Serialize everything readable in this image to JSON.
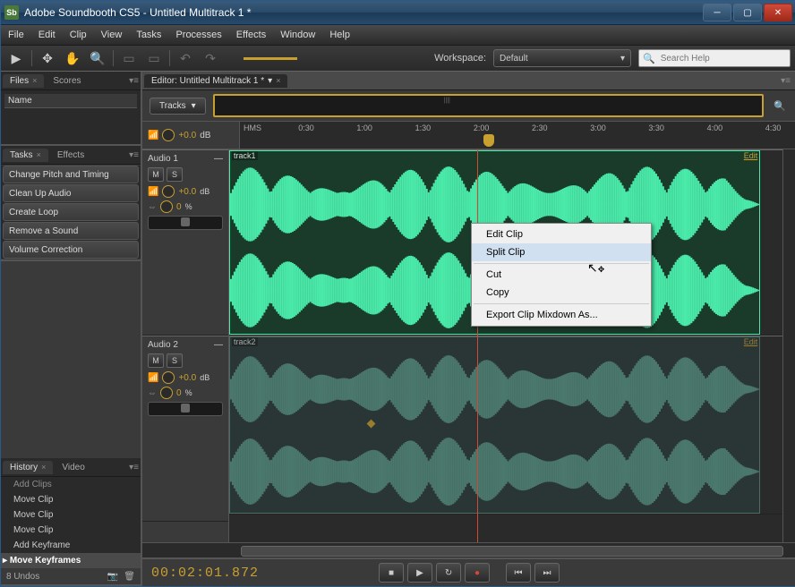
{
  "titlebar": {
    "app_icon": "Sb",
    "title": "Adobe Soundbooth CS5 - Untitled Multitrack 1 *"
  },
  "menubar": [
    "File",
    "Edit",
    "Clip",
    "View",
    "Tasks",
    "Processes",
    "Effects",
    "Window",
    "Help"
  ],
  "workspace": {
    "label": "Workspace:",
    "value": "Default"
  },
  "search": {
    "placeholder": "Search Help"
  },
  "files_panel": {
    "tabs": [
      "Files",
      "Scores"
    ],
    "column": "Name"
  },
  "tasks_panel": {
    "tabs": [
      "Tasks",
      "Effects"
    ],
    "items": [
      "Change Pitch and Timing",
      "Clean Up Audio",
      "Create Loop",
      "Remove a Sound",
      "Volume Correction"
    ]
  },
  "history_panel": {
    "tabs": [
      "History",
      "Video"
    ],
    "items": [
      "Add Clips",
      "Move Clip",
      "Move Clip",
      "Move Clip",
      "Add Keyframe",
      "Move Keyframes"
    ],
    "active_index": 5,
    "undo_count": "8 Undos"
  },
  "editor": {
    "tab": "Editor: Untitled Multitrack 1 *",
    "tracks_btn": "Tracks"
  },
  "master": {
    "db": "+0.0",
    "db_unit": "dB"
  },
  "ruler": {
    "hms": "HMS",
    "ticks": [
      "0:30",
      "1:00",
      "1:30",
      "2:00",
      "2:30",
      "3:00",
      "3:30",
      "4:00",
      "4:30"
    ]
  },
  "tracks": [
    {
      "name": "Audio 1",
      "clip": "track1",
      "db": "+0.0",
      "db_unit": "dB",
      "pct": "0",
      "pct_unit": "%",
      "edit": "Edit",
      "mute": "M",
      "solo": "S"
    },
    {
      "name": "Audio 2",
      "clip": "track2",
      "db": "+0.0",
      "db_unit": "dB",
      "pct": "0",
      "pct_unit": "%",
      "edit": "Edit",
      "mute": "M",
      "solo": "S"
    }
  ],
  "context_menu": {
    "items": [
      "Edit Clip",
      "Split Clip",
      "Cut",
      "Copy",
      "Export Clip Mixdown As..."
    ],
    "hover_index": 1
  },
  "transport": {
    "timecode": "00:02:01.872"
  },
  "colors": {
    "accent": "#c8a030",
    "waveform": "#4aeaaa",
    "playhead": "#d04a3a"
  }
}
